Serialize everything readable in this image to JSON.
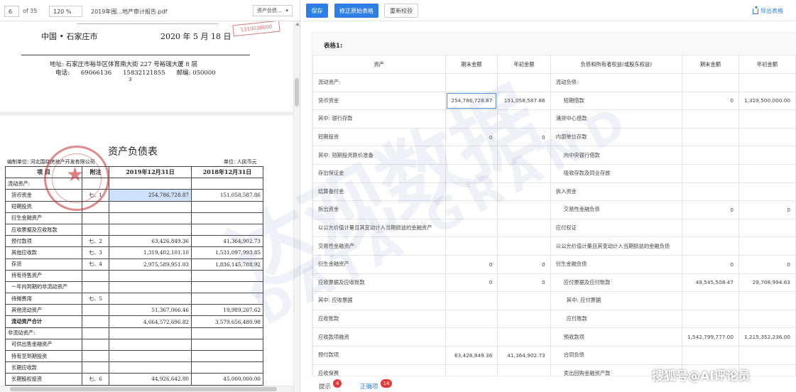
{
  "pdf_viewer": {
    "page_current": "6",
    "page_total": "of 35",
    "zoom": "120 %",
    "file_name": "2019年围...地产审计报告.pdf",
    "sheet_select": "资产负债..."
  },
  "page1": {
    "city": "中国 • 石家庄市",
    "date": "2020 年 5 月 18 日",
    "stamp_text": "1310030000",
    "address": "地址: 石家庄市裕华区体育南大街 227 号裕瑞大厦 8 层",
    "phone_label": "电话:",
    "phone1": "69066136",
    "phone2": "15832121855",
    "postcode": "邮编: 050000",
    "page_num": "3"
  },
  "page2": {
    "title": "资产负债表",
    "org": "编制单位: 河北围绕房地产开发有限公司",
    "unit": "单位: 人民币元",
    "headers": [
      "项  目",
      "附注",
      "2019年12月31日",
      "2018年12月31日"
    ],
    "rows": [
      [
        "流动资产:",
        "",
        "",
        ""
      ],
      [
        "货币资金",
        "七、1",
        "254,786,728.87",
        "151,058,587.86"
      ],
      [
        "短期投资",
        "",
        "",
        ""
      ],
      [
        "衍生金融资产",
        "",
        "",
        ""
      ],
      [
        "应收票据及应收账款",
        "",
        "",
        ""
      ],
      [
        "预付款项",
        "七、2",
        "63,426,849.36",
        "41,364,902.73"
      ],
      [
        "其他应收款",
        "七、3",
        "1,319,402,101.10",
        "1,531,097,993.85"
      ],
      [
        "存货",
        "七、4",
        "2,975,589,951.03",
        "1,836,145,788.92"
      ],
      [
        "持有待售资产",
        "",
        "",
        ""
      ],
      [
        "一年内到期的非流动资产",
        "",
        "",
        ""
      ],
      [
        "待摊费用",
        "七、5",
        "",
        ""
      ],
      [
        "其他流动资产",
        "",
        "51,367,066.46",
        "19,989,207.62"
      ],
      [
        "流动资产合计",
        "",
        "4,664,572,696.82",
        "3,579,656,480.98"
      ],
      [
        "非流动资产:",
        "",
        "",
        ""
      ],
      [
        "可供出售金融资产",
        "",
        "",
        ""
      ],
      [
        "持有至到期投资",
        "",
        "",
        ""
      ],
      [
        "长期应收款",
        "",
        "",
        ""
      ],
      [
        "长期股权投资",
        "七、6",
        "44,926,642.80",
        "45,000,000.00"
      ]
    ]
  },
  "toolbar": {
    "save": "保存",
    "fix_original": "修正原始表格",
    "recheck": "重新校验",
    "export": "导出表格"
  },
  "table": {
    "title": "表格1:",
    "headers": [
      "资产",
      "期末金额",
      "年初金额",
      "负债和所有者权益(或股东权益)",
      "期末金额",
      "年初金额"
    ],
    "rows": [
      [
        "流动资产:",
        "",
        "",
        "流动负债:",
        "",
        ""
      ],
      [
        "货币资金",
        "254,786,728.87",
        "151,058,587.86",
        "短期借款",
        "0",
        "1,329,500,000.00"
      ],
      [
        "其中: 银行存款",
        "",
        "",
        "涌贷中心借款",
        "",
        ""
      ],
      [
        "短期投资",
        "0",
        "0",
        "内部单位存款",
        "",
        ""
      ],
      [
        "其中: 短期投资跌价准备",
        "",
        "",
        "向中央银行借款",
        "",
        ""
      ],
      [
        "存出保证金",
        "",
        "",
        "吸收存款及同业存放",
        "",
        ""
      ],
      [
        "结算备付金",
        "",
        "",
        "拆入资金",
        "",
        ""
      ],
      [
        "拆出资金",
        "",
        "",
        "交易性金融负债",
        "0",
        "0"
      ],
      [
        "以公允价值计量且其变动计入当期损益的金融资产",
        "",
        "",
        "应付权证",
        "",
        ""
      ],
      [
        "交易性金融资产",
        "",
        "",
        "以公允价值计量且其变动计入当期损益的金融负债",
        "",
        ""
      ],
      [
        "衍生金融资产",
        "0",
        "0",
        "衍生金融负债",
        "0",
        "0"
      ],
      [
        "应收票据及应收账款",
        "0",
        "0",
        "应付票据及应付账款",
        "49,545,508.47",
        "29,708,994.63"
      ],
      [
        "其中: 应收票据",
        "",
        "",
        "其中: 应付票据",
        "",
        ""
      ],
      [
        "应收账款",
        "",
        "",
        "应付账款",
        "",
        ""
      ],
      [
        "应收款项融资",
        "",
        "",
        "预收款项",
        "1,542,799,777.00",
        "1,215,352,236.00"
      ],
      [
        "预付款项",
        "63,426,849.36",
        "41,364,902.73",
        "合同负债",
        "",
        ""
      ],
      [
        "应收保费",
        "",
        "",
        "卖出回购金融资产款",
        "",
        ""
      ]
    ]
  },
  "tabs": {
    "hint_label": "提示",
    "hint_count": "4",
    "correct_label": "正确项",
    "correct_count": "14"
  },
  "watermark": {
    "cn": "达观数据",
    "en": "DATA GRAND",
    "footer": "搜狐号@AI评论员"
  },
  "colors": {
    "primary": "#2d7fe8",
    "badge": "#e53935",
    "selection": "#cfe2fb",
    "seal": "#c82828"
  }
}
